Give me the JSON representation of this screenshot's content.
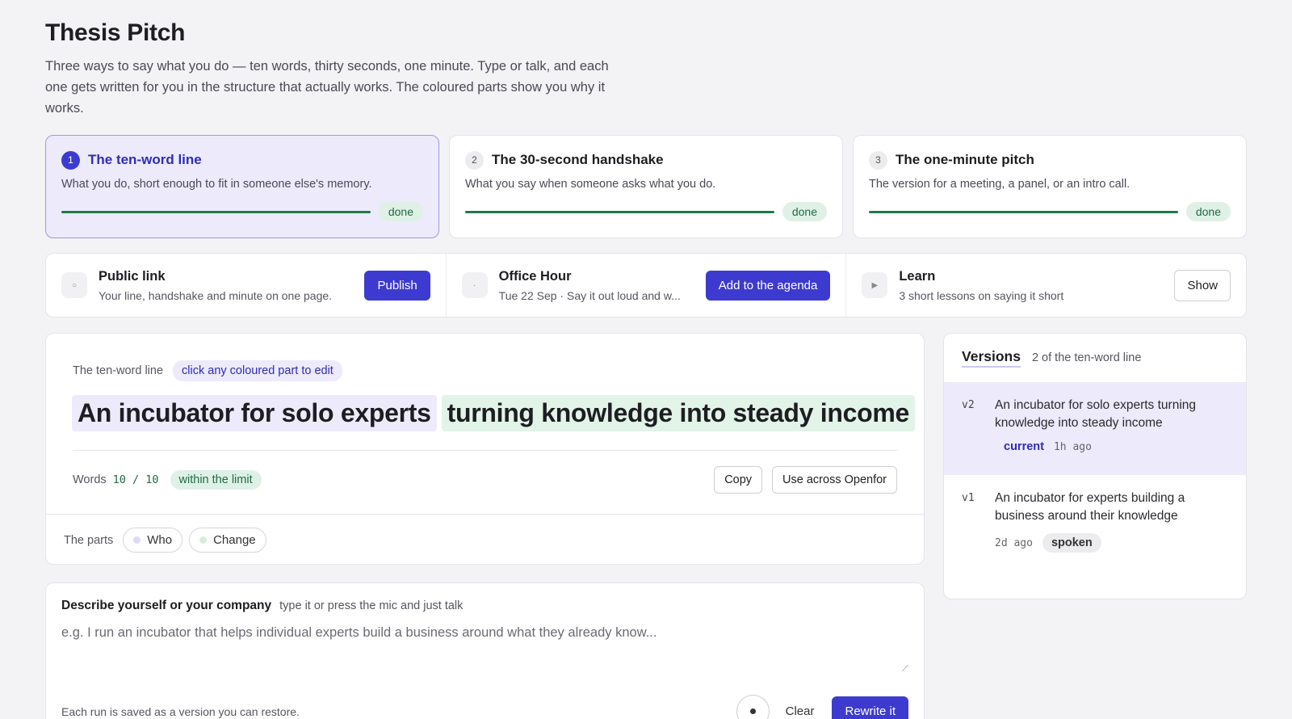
{
  "header": {
    "title": "Thesis Pitch",
    "intro": "Three ways to say what you do — ten words, thirty seconds, one minute. Type or talk, and each one gets written for you in the structure that actually works. The coloured parts show you why it works."
  },
  "steps": [
    {
      "num": "1",
      "title": "The ten-word line",
      "desc": "What you do, short enough to fit in someone else's memory.",
      "status": "done",
      "progress": 1.0,
      "active": true
    },
    {
      "num": "2",
      "title": "The 30-second handshake",
      "desc": "What you say when someone asks what you do.",
      "status": "done",
      "progress": 1.0,
      "active": false
    },
    {
      "num": "3",
      "title": "The one-minute pitch",
      "desc": "The version for a meeting, a panel, or an intro call.",
      "status": "done",
      "progress": 1.0,
      "active": false
    }
  ],
  "actions": {
    "public_link": {
      "icon": "circle-icon",
      "title": "Public link",
      "sub": "Your line, handshake and minute on one page.",
      "button": "Publish"
    },
    "office_hour": {
      "icon": "dot-icon",
      "title": "Office Hour",
      "sub": "Tue 22 Sep · Say it out loud and w...",
      "button": "Add to the agenda"
    },
    "learn": {
      "icon": "play-icon",
      "title": "Learn",
      "sub": "3 short lessons on saying it short",
      "button": "Show"
    }
  },
  "editor": {
    "label": "The ten-word line",
    "hint": "click any coloured part to edit",
    "segments": {
      "who": "An incubator for solo experts",
      "change": "turning knowledge into steady income"
    },
    "words_label": "Words",
    "words_count": "10 / 10",
    "within": "within the limit",
    "copy_label": "Copy",
    "use_label": "Use across Openfor",
    "parts_label": "The parts",
    "parts": [
      {
        "label": "Who",
        "color": "#dcdaf6"
      },
      {
        "label": "Change",
        "color": "#d5ecdd"
      }
    ]
  },
  "versions": {
    "title": "Versions",
    "subtitle": "2 of the ten-word line",
    "items": [
      {
        "id": "v2",
        "text": "An incubator for solo experts turning knowledge into steady income",
        "tag": "current",
        "time": "1h ago"
      },
      {
        "id": "v1",
        "text": "An incubator for experts building a business around their knowledge",
        "time": "2d ago",
        "tag": "spoken"
      }
    ]
  },
  "describe": {
    "title": "Describe yourself or your company",
    "hint": "type it or press the mic and just talk",
    "placeholder": "e.g. I run an incubator that helps individual experts build a business around what they already know...",
    "note": "Each run is saved as a version you can restore.",
    "clear_label": "Clear",
    "rewrite_label": "Rewrite it"
  },
  "colors": {
    "accent": "#3d3bcf",
    "success": "#1f7a4a",
    "who_highlight": "#eceafb",
    "change_highlight": "#e2f3e8"
  }
}
